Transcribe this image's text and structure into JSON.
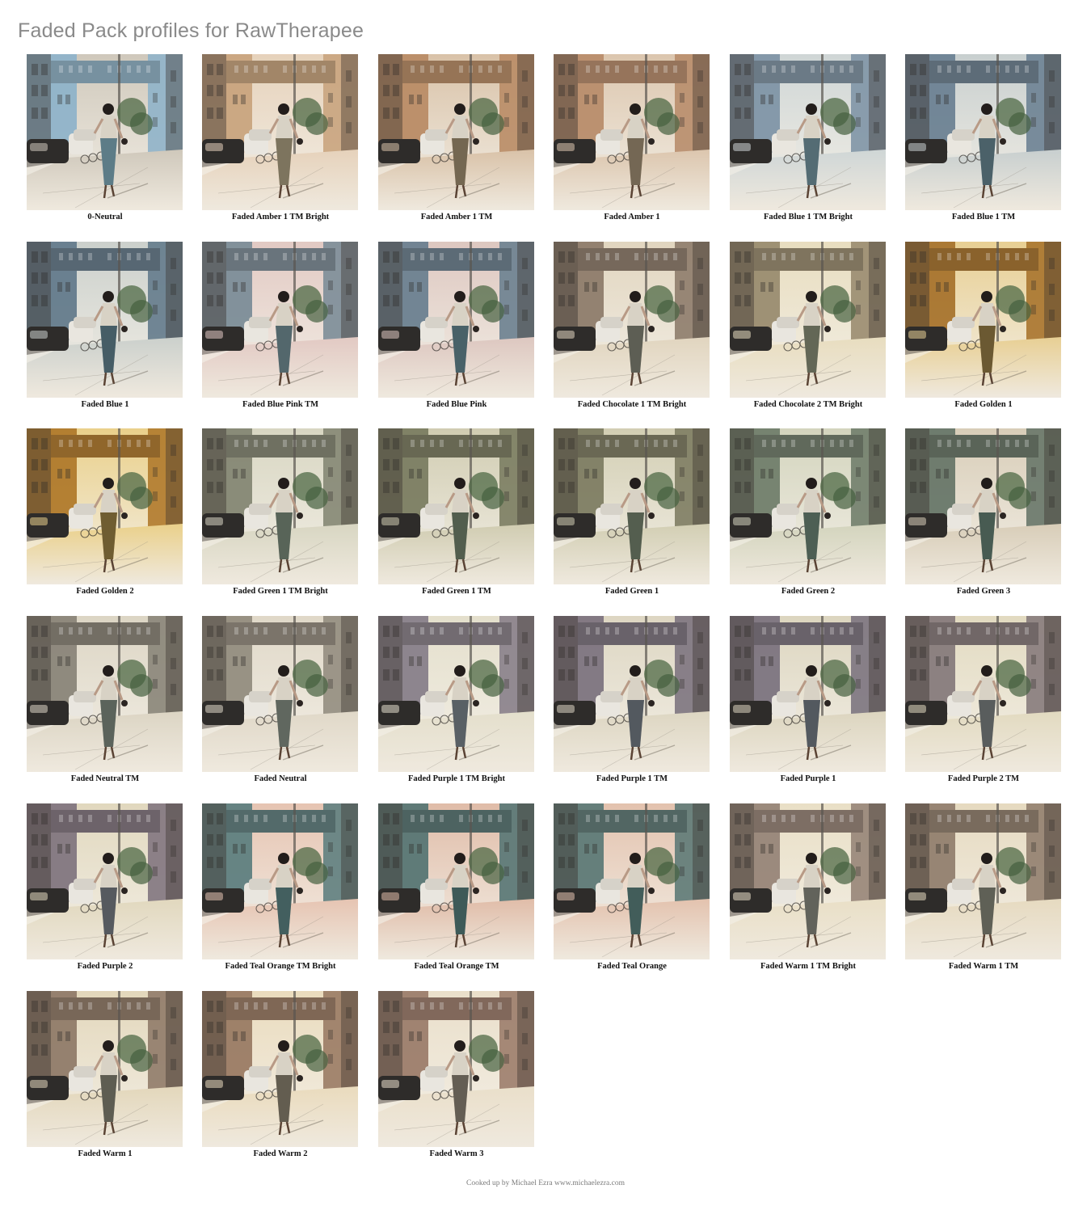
{
  "page": {
    "title": "Faded Pack profiles for RawTherapee",
    "footer": "Cooked up by Michael Ezra www.michaelezra.com"
  },
  "profiles": [
    {
      "label": "0-Neutral",
      "tint": "#8fb3c9",
      "tone": "#cfc8bb"
    },
    {
      "label": "Faded Amber 1 TM Bright",
      "tint": "#c9a47e",
      "tone": "#e6d2bb"
    },
    {
      "label": "Faded Amber 1 TM",
      "tint": "#b98c66",
      "tone": "#d9c2a8"
    },
    {
      "label": "Faded Amber 1",
      "tint": "#b88d6c",
      "tone": "#dcc6ae"
    },
    {
      "label": "Faded Blue 1 TM Bright",
      "tint": "#7f95a6",
      "tone": "#cfd6d6"
    },
    {
      "label": "Faded Blue 1 TM",
      "tint": "#6d8293",
      "tone": "#c8cfcf"
    },
    {
      "label": "Faded Blue 1",
      "tint": "#647b8c",
      "tone": "#cbd0cc"
    },
    {
      "label": "Faded Blue Pink TM",
      "tint": "#7c8d98",
      "tone": "#e2c9c3"
    },
    {
      "label": "Faded Blue Pink",
      "tint": "#6b8190",
      "tone": "#ddc7c0"
    },
    {
      "label": "Faded Chocolate 1 TM Bright",
      "tint": "#8e7c6c",
      "tone": "#e1d5bf"
    },
    {
      "label": "Faded Chocolate 2 TM Bright",
      "tint": "#9a8c70",
      "tone": "#e8ddbf"
    },
    {
      "label": "Faded Golden 1",
      "tint": "#a8742e",
      "tone": "#e8cf93"
    },
    {
      "label": "Faded Golden 2",
      "tint": "#b07a2c",
      "tone": "#ead08a"
    },
    {
      "label": "Faded Green 1 TM Bright",
      "tint": "#858774",
      "tone": "#d8d6c2"
    },
    {
      "label": "Faded Green 1 TM",
      "tint": "#7b7d62",
      "tone": "#d0ccb1"
    },
    {
      "label": "Faded Green 1",
      "tint": "#7e7d63",
      "tone": "#d2ceb3"
    },
    {
      "label": "Faded Green 2",
      "tint": "#717e6c",
      "tone": "#d3d4bd"
    },
    {
      "label": "Faded Green 3",
      "tint": "#687769",
      "tone": "#d8cdb8"
    },
    {
      "label": "Faded Neutral TM",
      "tint": "#8a8579",
      "tone": "#dcd5c4"
    },
    {
      "label": "Faded Neutral",
      "tint": "#948d80",
      "tone": "#e0d8c8"
    },
    {
      "label": "Faded Purple 1 TM Bright",
      "tint": "#88808a",
      "tone": "#e4dfcc"
    },
    {
      "label": "Faded Purple 1 TM",
      "tint": "#7d7480",
      "tone": "#ddd6c2"
    },
    {
      "label": "Faded Purple 1",
      "tint": "#7c7480",
      "tone": "#dcd5bf"
    },
    {
      "label": "Faded Purple 2 TM",
      "tint": "#877b7c",
      "tone": "#e2dac0"
    },
    {
      "label": "Faded Purple 2",
      "tint": "#827680",
      "tone": "#e1d8be"
    },
    {
      "label": "Faded Teal Orange TM Bright",
      "tint": "#5f7f80",
      "tone": "#e6c4b2"
    },
    {
      "label": "Faded Teal Orange TM",
      "tint": "#577674",
      "tone": "#e0bca8"
    },
    {
      "label": "Faded Teal Orange",
      "tint": "#5e7a77",
      "tone": "#e3c2ae"
    },
    {
      "label": "Faded Warm 1 TM Bright",
      "tint": "#978578",
      "tone": "#e9dfc6"
    },
    {
      "label": "Faded Warm 1 TM",
      "tint": "#92806f",
      "tone": "#e6dac0"
    },
    {
      "label": "Faded Warm 1",
      "tint": "#907b69",
      "tone": "#e3d7bb"
    },
    {
      "label": "Faded Warm 2",
      "tint": "#9a7b64",
      "tone": "#eadbbd"
    },
    {
      "label": "Faded Warm 3",
      "tint": "#9c7d6c",
      "tone": "#eadfca"
    }
  ]
}
